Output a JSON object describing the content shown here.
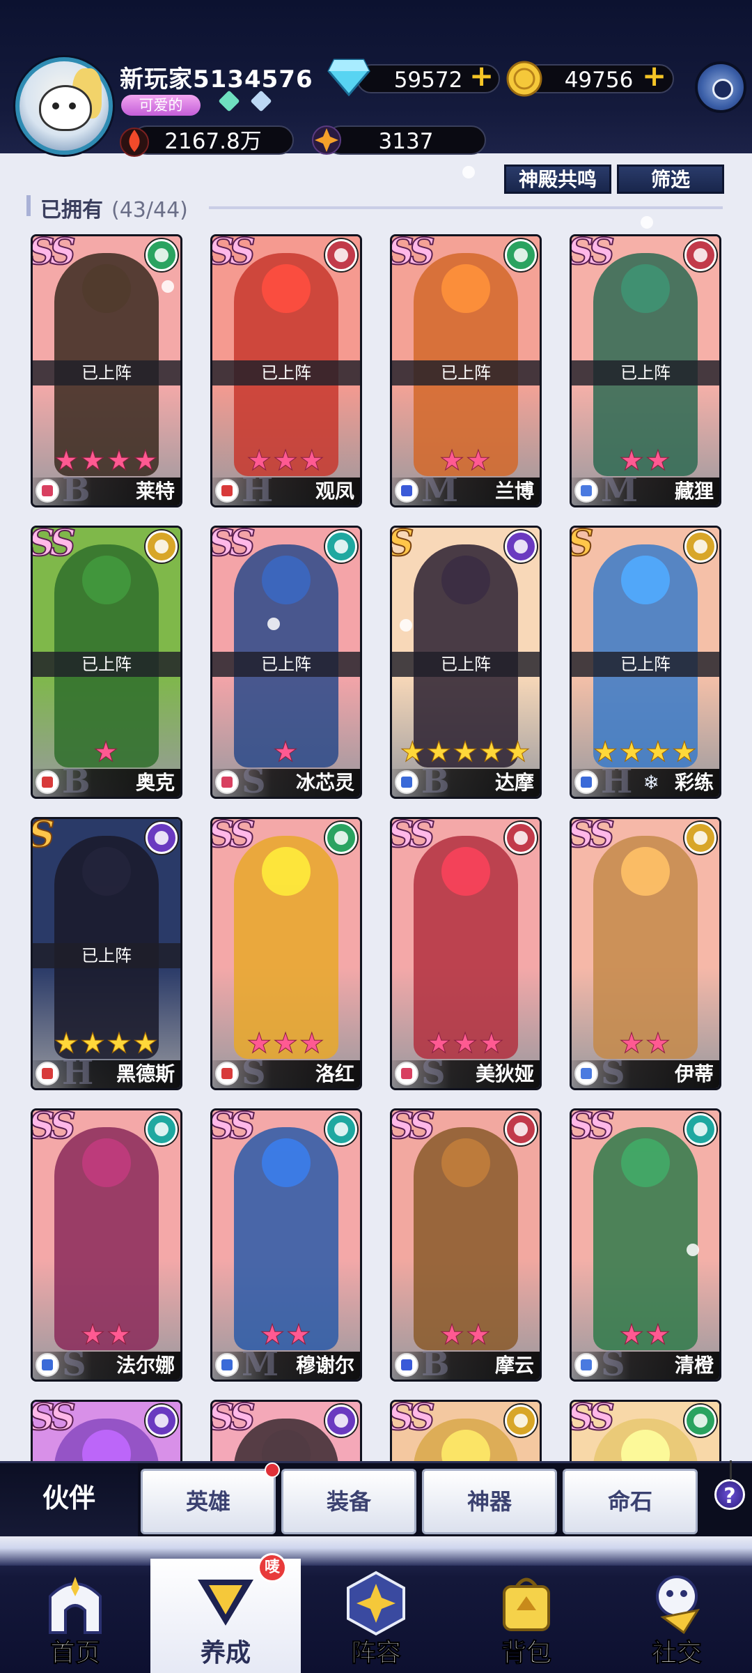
{
  "header": {
    "player_name": "新玩家5134576",
    "title_badge": "可爱的",
    "diamonds": "59572",
    "gold": "49756",
    "power": "2167.8万",
    "energy": "3137"
  },
  "toolbar": {
    "resonance_button": "神殿共鸣",
    "filter_button": "筛选",
    "owned_label": "已拥有",
    "owned_count": "(43/44)"
  },
  "deployed_text": "已上阵",
  "heroes": [
    {
      "name": "莱特",
      "rank": "SS",
      "stars": 4,
      "star_color": "pink",
      "deployed": true,
      "faction_color": "#2aa360",
      "role_color": "#d84060",
      "bg": "#f4a9a8",
      "figure": "#3a2a20",
      "class_letter": "B"
    },
    {
      "name": "观凤",
      "rank": "SS",
      "stars": 3,
      "star_color": "pink",
      "deployed": true,
      "faction_color": "#c23a4a",
      "role_color": "#d83a3a",
      "bg": "#f59a90",
      "figure": "#c7382e",
      "class_letter": "H"
    },
    {
      "name": "兰博",
      "rank": "SS",
      "stars": 2,
      "star_color": "pink",
      "deployed": true,
      "faction_color": "#2aa360",
      "role_color": "#3a5ad8",
      "bg": "#f4a296",
      "figure": "#d2682a",
      "class_letter": "M"
    },
    {
      "name": "藏狸",
      "rank": "SS",
      "stars": 2,
      "star_color": "pink",
      "deployed": true,
      "faction_color": "#c23a4a",
      "role_color": "#4a7ae0",
      "bg": "#f6b0a8",
      "figure": "#2d6a52",
      "class_letter": "M"
    },
    {
      "name": "奥克",
      "rank": "SS",
      "stars": 1,
      "star_color": "pink",
      "deployed": true,
      "faction_color": "#d8a628",
      "role_color": "#d83a3a",
      "bg": "#7fb84a",
      "figure": "#2f6e2c",
      "class_letter": "B"
    },
    {
      "name": "冰芯灵",
      "rank": "SS",
      "stars": 1,
      "star_color": "pink",
      "deployed": true,
      "faction_color": "#1fa8a0",
      "role_color": "#d84060",
      "bg": "#f4a4a8",
      "figure": "#2a4a8a",
      "class_letter": "S"
    },
    {
      "name": "达摩",
      "rank": "S",
      "stars": 5,
      "star_color": "gold",
      "deployed": true,
      "faction_color": "#6a3ac0",
      "role_color": "#3a6ad8",
      "bg": "#f8d8b8",
      "figure": "#2a2030",
      "class_letter": "B"
    },
    {
      "name": "彩练",
      "rank": "S",
      "stars": 4,
      "star_color": "gold",
      "deployed": true,
      "faction_color": "#d8a628",
      "role_color": "#3a6ad8",
      "bg": "#f5c0a8",
      "figure": "#3a7ac8",
      "class_letter": "H"
    },
    {
      "name": "黑德斯",
      "rank": "S",
      "stars": 4,
      "star_color": "gold",
      "deployed": true,
      "faction_color": "#6a3ac0",
      "role_color": "#d83a3a",
      "bg": "#2a3a68",
      "figure": "#1a1a2a",
      "class_letter": "H"
    },
    {
      "name": "洛红",
      "rank": "SS",
      "stars": 3,
      "star_color": "pink",
      "deployed": false,
      "faction_color": "#2aa360",
      "role_color": "#d83a3a",
      "bg": "#f4a8a8",
      "figure": "#e8a82a",
      "class_letter": "S"
    },
    {
      "name": "美狄娅",
      "rank": "SS",
      "stars": 3,
      "star_color": "pink",
      "deployed": false,
      "faction_color": "#c23a4a",
      "role_color": "#d84060",
      "bg": "#f4a8a8",
      "figure": "#b23040",
      "class_letter": "S"
    },
    {
      "name": "伊蒂",
      "rank": "SS",
      "stars": 2,
      "star_color": "pink",
      "deployed": false,
      "faction_color": "#d8a628",
      "role_color": "#4a7ae0",
      "bg": "#f6b8a8",
      "figure": "#c48a4a",
      "class_letter": "S"
    },
    {
      "name": "法尔娜",
      "rank": "SS",
      "stars": 2,
      "star_color": "pink",
      "deployed": false,
      "faction_color": "#1fa8a0",
      "role_color": "#3a6ad8",
      "bg": "#f4a8a8",
      "figure": "#8a2a5a",
      "class_letter": "S"
    },
    {
      "name": "穆谢尔",
      "rank": "SS",
      "stars": 2,
      "star_color": "pink",
      "deployed": false,
      "faction_color": "#1fa8a0",
      "role_color": "#3a6ad8",
      "bg": "#f4a8a8",
      "figure": "#2a5aa8",
      "class_letter": "M"
    },
    {
      "name": "摩云",
      "rank": "SS",
      "stars": 2,
      "star_color": "pink",
      "deployed": false,
      "faction_color": "#c23a4a",
      "role_color": "#3a5ad8",
      "bg": "#f2a8a0",
      "figure": "#8a5a2a",
      "class_letter": "B"
    },
    {
      "name": "清橙",
      "rank": "SS",
      "stars": 2,
      "star_color": "pink",
      "deployed": false,
      "faction_color": "#1fa8a0",
      "role_color": "#4a7ae0",
      "bg": "#f4b0a8",
      "figure": "#2f7a4a",
      "class_letter": "S"
    },
    {
      "name": "",
      "rank": "SS",
      "stars": 0,
      "star_color": "pink",
      "deployed": false,
      "faction_color": "#6a3ac0",
      "role_color": "#d84060",
      "bg": "#d890e8",
      "figure": "#8a4ac0",
      "class_letter": ""
    },
    {
      "name": "",
      "rank": "SS",
      "stars": 0,
      "star_color": "pink",
      "deployed": false,
      "faction_color": "#6a3ac0",
      "role_color": "#d84060",
      "bg": "#f4a8b8",
      "figure": "#3a2a30",
      "class_letter": ""
    },
    {
      "name": "",
      "rank": "SS",
      "stars": 0,
      "star_color": "pink",
      "deployed": false,
      "faction_color": "#d8a628",
      "role_color": "#d84060",
      "bg": "#f4c8a0",
      "figure": "#d8a84a",
      "class_letter": ""
    },
    {
      "name": "",
      "rank": "SS",
      "stars": 0,
      "star_color": "pink",
      "deployed": false,
      "faction_color": "#2aa360",
      "role_color": "#d84060",
      "bg": "#f8d8a8",
      "figure": "#e8c870",
      "class_letter": ""
    }
  ],
  "tabs": {
    "active": "伙伴",
    "items": [
      "英雄",
      "装备",
      "神器",
      "命石"
    ],
    "help": "?"
  },
  "nav": {
    "items": [
      "首页",
      "养成",
      "阵容",
      "背包",
      "社交"
    ],
    "badge": "唛"
  }
}
